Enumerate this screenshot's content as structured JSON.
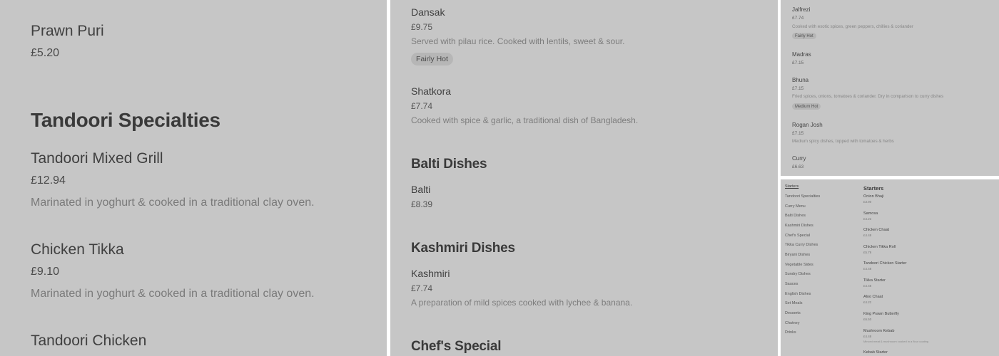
{
  "panel1": {
    "item_prawn_puri": {
      "name": "Prawn Puri",
      "price": "£5.20"
    },
    "heading": "Tandoori Specialties",
    "items": [
      {
        "name": "Tandoori Mixed Grill",
        "price": "£12.94",
        "description": "Marinated in yoghurt & cooked in a traditional clay oven."
      },
      {
        "name": "Chicken Tikka",
        "price": "£9.10",
        "description": "Marinated in yoghurt & cooked in a traditional clay oven."
      },
      {
        "name": "Tandoori Chicken"
      }
    ]
  },
  "panel2": {
    "dansak": {
      "name": "Dansak",
      "price": "£9.75",
      "description": "Served with pilau rice. Cooked with lentils, sweet & sour.",
      "tag": "Fairly Hot"
    },
    "shatkora": {
      "name": "Shatkora",
      "price": "£7.74",
      "description": "Cooked with spice & garlic, a traditional dish of Bangladesh."
    },
    "balti_heading": "Balti Dishes",
    "balti": {
      "name": "Balti",
      "price": "£8.39"
    },
    "kashmiri_heading": "Kashmiri Dishes",
    "kashmiri": {
      "name": "Kashmiri",
      "price": "£7.74",
      "description": "A preparation of mild spices cooked with lychee & banana."
    },
    "chefs_heading": "Chef's Special"
  },
  "panel3": {
    "jalfrezi": {
      "name": "Jalfrezi",
      "price": "£7.74",
      "description": "Cooked with exotic spices, green peppers, chillies & coriander",
      "tag": "Fairly Hot"
    },
    "madras": {
      "name": "Madras",
      "price": "£7.15"
    },
    "bhuna": {
      "name": "Bhuna",
      "price": "£7.15",
      "description": "Fried spices, onions, tomatoes & coriander. Dry in comparison to curry dishes",
      "tag": "Medium Hot"
    },
    "rogan": {
      "name": "Rogan Josh",
      "price": "£7.15",
      "description": "Medium spicy dishes, topped with tomatoes & herbs"
    },
    "curry": {
      "name": "Curry",
      "price": "£6.63"
    }
  },
  "panel4": {
    "nav": [
      "Starters",
      "Tandoori Specialties",
      "Curry Menu",
      "Balti Dishes",
      "Kashmiri Dishes",
      "Chef's Special",
      "Tikka Curry Dishes",
      "Biryani Dishes",
      "Vegetable Sides",
      "Sundry Dishes",
      "Sauces",
      "English Dishes",
      "Set Meals",
      "Desserts",
      "Chutney",
      "Drinks"
    ],
    "section_title": "Starters",
    "items": [
      {
        "name": "Onion Bhaji",
        "price": "£3.90"
      },
      {
        "name": "Samosa",
        "price": "£4.22"
      },
      {
        "name": "Chicken Chaat",
        "price": "£4.48"
      },
      {
        "name": "Chicken Tikka Roll",
        "price": "£5.78"
      },
      {
        "name": "Tandoori Chicken Starter",
        "price": "£4.48"
      },
      {
        "name": "Tikka Starter",
        "price": "£4.48"
      },
      {
        "name": "Aloo Chaat",
        "price": "£4.22"
      },
      {
        "name": "King Prawn Butterfly",
        "price": "£6.50"
      },
      {
        "name": "Mushroom Kebab",
        "price": "£4.48",
        "description": "Minced meat & mushroom cooked in a flour coating"
      },
      {
        "name": "Kebab Starter"
      }
    ]
  }
}
